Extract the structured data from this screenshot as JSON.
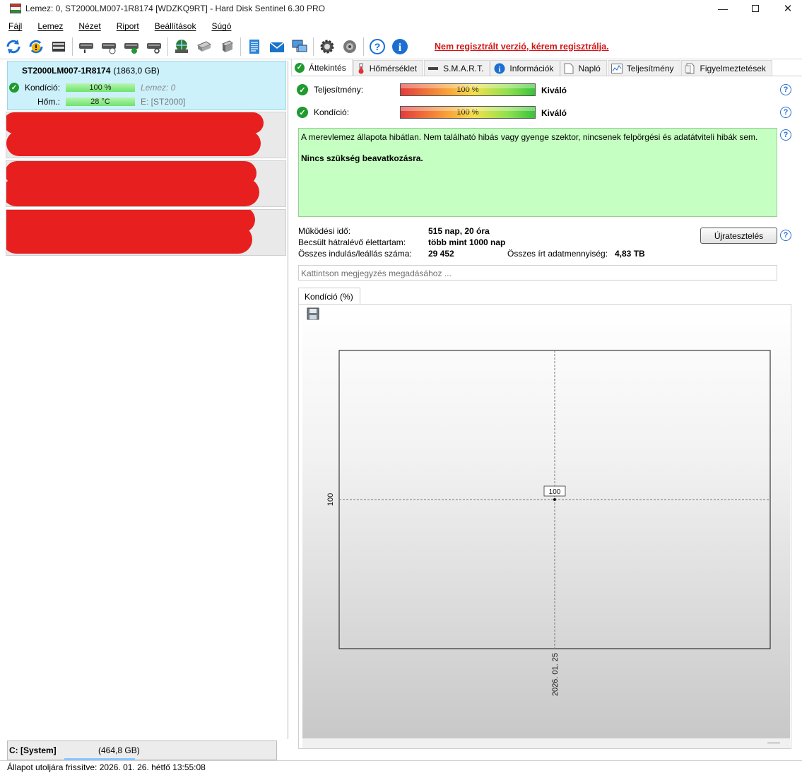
{
  "window": {
    "title": "Lemez: 0, ST2000LM007-1R8174 [WDZKQ9RT]  -  Hard Disk Sentinel 6.30 PRO",
    "minimize_glyph": "—",
    "maximize_glyph": "",
    "close_glyph": "✕"
  },
  "menu": [
    "Fájl",
    "Lemez",
    "Nézet",
    "Riport",
    "Beállítások",
    "Súgó"
  ],
  "toolbar": {
    "registration_notice": "Nem regisztrált verzió, kérem regisztrálja."
  },
  "left": {
    "disk": {
      "name": "ST2000LM007-1R8174",
      "size": "(1863,0 GB)",
      "condition_label": "Kondíció:",
      "condition_value": "100 %",
      "disk_index": "Lemez: 0",
      "temp_label": "Hőm.:",
      "temp_value": "28 °C",
      "volume": "E: [ST2000]"
    },
    "drive": {
      "name": "C: [System]",
      "size": "(464,8 GB)"
    }
  },
  "tabs": [
    {
      "label": "Áttekintés",
      "icon": "check-icon"
    },
    {
      "label": "Hőmérséklet",
      "icon": "thermometer-icon"
    },
    {
      "label": "S.M.A.R.T.",
      "icon": "smart-icon"
    },
    {
      "label": "Információk",
      "icon": "info-icon"
    },
    {
      "label": "Napló",
      "icon": "log-icon"
    },
    {
      "label": "Teljesítmény",
      "icon": "performance-icon"
    },
    {
      "label": "Figyelmeztetések",
      "icon": "alerts-icon"
    }
  ],
  "overview": {
    "performance_label": "Teljesítmény:",
    "performance_value": "100 %",
    "performance_rating": "Kiváló",
    "condition_label": "Kondíció:",
    "condition_value": "100 %",
    "condition_rating": "Kiváló",
    "message_line1": "A merevlemez állapota hibátlan. Nem található hibás vagy gyenge szektor, nincsenek felpörgési és adatátviteli hibák sem.",
    "message_line2": "Nincs szükség beavatkozásra.",
    "power_on_label": "Működési idő:",
    "power_on_value": "515 nap, 20 óra",
    "lifetime_label": "Becsült hátralévő élettartam:",
    "lifetime_value": "több mint 1000 nap",
    "start_stop_label": "Összes indulás/leállás száma:",
    "start_stop_value": "29 452",
    "written_label": "Összes írt adatmennyiség:",
    "written_value": "4,83 TB",
    "retest_button": "Újratesztelés",
    "note_placeholder": "Kattintson megjegyzés megadásához ..."
  },
  "chart_tab": "Kondíció  (%)",
  "chart_data": {
    "type": "line",
    "title": "",
    "x": [
      "2026. 01. 25"
    ],
    "series": [
      {
        "values": [
          100
        ]
      }
    ],
    "y_tick": "100",
    "x_tick": "2026. 01. 25",
    "point_label": "100"
  },
  "status": {
    "text": "Állapot utoljára frissítve: 2026. 01. 26. hétfő 13:55:08"
  }
}
